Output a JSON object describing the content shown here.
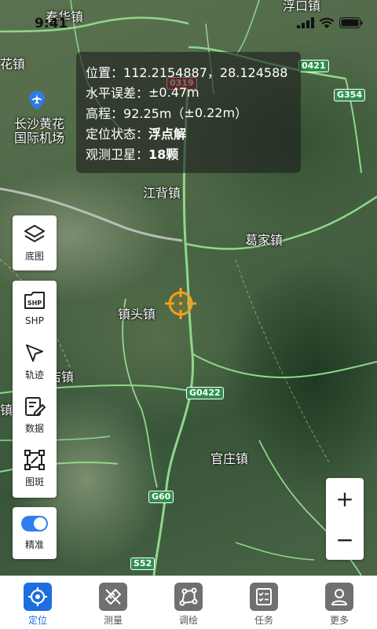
{
  "status_bar": {
    "time": "9:41"
  },
  "map": {
    "places": {
      "chunhua": "春华镇",
      "fukou": "浮口镇",
      "huazhen": "花镇",
      "airport_line1": "长沙黄花",
      "airport_line2": "国际机场",
      "jiangbei": "江背镇",
      "gejia": "葛家镇",
      "zhentou": "镇头镇",
      "gaodian": "店镇",
      "zhen_left": "镇",
      "guanzhuang": "官庄镇"
    },
    "shields": {
      "g0421": "0421",
      "g354": "G354",
      "s0319": "0319",
      "g0422": "G0422",
      "g60": "G60",
      "s52": "S52"
    }
  },
  "info_panel": {
    "position_label": "位置：",
    "position_value": "112.2154887，28.124588",
    "horizontal_error_label": "水平误差：",
    "horizontal_error_value": "±0.47m",
    "elevation_label": "高程：",
    "elevation_value": "92.25m（",
    "elevation_error": "±0.22m",
    "elevation_close": "）",
    "status_label": "定位状态：",
    "status_value": "浮点解",
    "satellites_label": "观测卫星：",
    "satellites_value": "18颗"
  },
  "toolbar": {
    "basemap": "底图",
    "shp_icon_text": "SHP",
    "shp": "SHP",
    "track": "轨迹",
    "data": "数据",
    "patch": "图斑",
    "precise": "精准",
    "precise_on": true
  },
  "zoom": {
    "in": "+",
    "out": "−"
  },
  "bottom_nav": [
    {
      "label": "定位",
      "icon": "locate-icon",
      "active": true
    },
    {
      "label": "测量",
      "icon": "measure-icon",
      "active": false
    },
    {
      "label": "调绘",
      "icon": "draw-icon",
      "active": false
    },
    {
      "label": "任务",
      "icon": "task-icon",
      "active": false
    },
    {
      "label": "更多",
      "icon": "more-icon",
      "active": false
    }
  ],
  "colors": {
    "accent": "#1d6fe0",
    "road": "#7bd07b",
    "crosshair": "#f0a020",
    "good": "#2ecc71"
  }
}
